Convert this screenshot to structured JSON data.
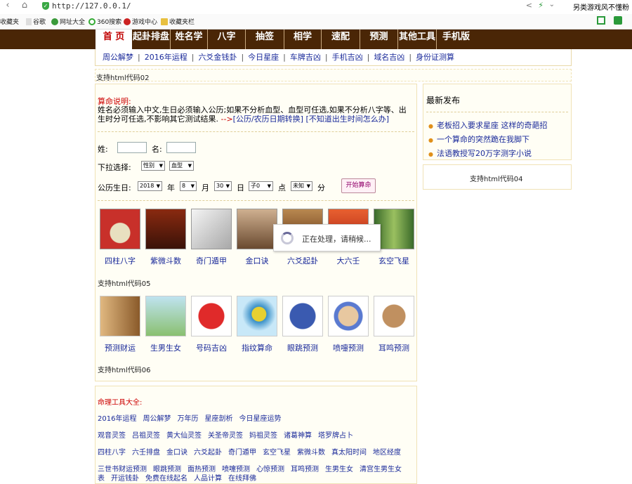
{
  "browser": {
    "url": "http://127.0.0.1/",
    "right_text": "另类游戏风不懂粉",
    "bookmarks": [
      {
        "label": "收藏夹",
        "color": "#f0b030"
      },
      {
        "label": "谷歌",
        "color": "#bbbbbb"
      },
      {
        "label": "网址大全",
        "color": "#3a9a3a"
      },
      {
        "label": "360搜索",
        "color": "#33aa33"
      },
      {
        "label": "游戏中心",
        "color": "#cc2222"
      },
      {
        "label": "收藏夹栏",
        "color": "#e8c040"
      }
    ]
  },
  "main_nav": [
    "首 页",
    "起卦排盘",
    "姓名学",
    "八字",
    "抽签",
    "相学",
    "速配",
    "预测",
    "其他工具",
    "手机版"
  ],
  "sub_nav": [
    "周公解梦",
    "2016年运程",
    "六爻金钱卦",
    "今日星座",
    "车牌吉凶",
    "手机吉凶",
    "域名吉凶",
    "身份证测算"
  ],
  "code_labels": {
    "c02": "支持html代码02",
    "c04": "支持html代码04",
    "c05": "支持html代码05",
    "c06": "支持html代码06"
  },
  "note": {
    "title": "算命说明:",
    "line1": "姓名必须输入中文,生日必须输入公历;如果不分析血型、血型可任选,如果不分析八字等、出生时分可任选,不影响其它测试结果.",
    "arrow": "-->",
    "link1": "[公历/农历日期转换]",
    "link2": "[不知道出生时间怎么办]"
  },
  "form": {
    "surname_label": "姓:",
    "name_label": "名:",
    "dropdown_label": "下拉选择:",
    "gender": "性别",
    "blood": "血型",
    "birth_label": "公历生日:",
    "year": "2018",
    "year_unit": "年",
    "month": "8",
    "month_unit": "月",
    "day": "30",
    "day_unit": "日",
    "hour": "子0",
    "hour_unit": "点",
    "minute": "未知",
    "minute_unit": "分",
    "submit": "开始算命"
  },
  "tiles_row1": [
    {
      "label": "四柱八字",
      "color": "#c8302a"
    },
    {
      "label": "紫微斗数",
      "color": "#8a2a10"
    },
    {
      "label": "奇门遁甲",
      "color": "#c8c8c8"
    },
    {
      "label": "金口诀",
      "color": "#a88060"
    },
    {
      "label": "六爻起卦",
      "color": "#a06a30"
    },
    {
      "label": "大六壬",
      "color": "#d84020"
    },
    {
      "label": "玄空飞星",
      "color": "#5a8a3a"
    }
  ],
  "tiles_row2": [
    {
      "label": "预测财运",
      "color": "#c89a5a"
    },
    {
      "label": "生男生女",
      "color": "#aac890"
    },
    {
      "label": "号码吉凶",
      "color": "#e83a3a"
    },
    {
      "label": "指纹算命",
      "color": "#4aa0d0"
    },
    {
      "label": "眼跳预测",
      "color": "#3a6ab0"
    },
    {
      "label": "喷嚏预测",
      "color": "#6a8ad0"
    },
    {
      "label": "耳鸣预测",
      "color": "#a0703a"
    }
  ],
  "loading_text": "正在处理，请稍候...",
  "sidebar": {
    "title": "最新发布",
    "items": [
      "老板招入要求星座 这样的奇葩招",
      "一个算命的突然跪在我脚下",
      "法语教授写20万字测字小说"
    ]
  },
  "tools": {
    "title": "命理工具大全:",
    "rows": [
      [
        "2016年运程",
        "周公解梦",
        "万年历",
        "星座剖析",
        "今日星座运势"
      ],
      [
        "观音灵签",
        "吕祖灵签",
        "黄大仙灵签",
        "关圣帝灵签",
        "妈祖灵签",
        "诸葛神算",
        "塔罗牌占卜"
      ],
      [
        "四柱八字",
        "六壬排盘",
        "金口诀",
        "六爻起卦",
        "奇门遁甲",
        "玄空飞星",
        "紫微斗数",
        "真太阳时间",
        "地区经度"
      ],
      [
        "三世书财运预测",
        "眼跳预测",
        "面热预测",
        "喷嚏预测",
        "心惊预测",
        "耳鸣预测",
        "生男生女",
        "清宫生男生女"
      ],
      [
        "表",
        "开运钱卦",
        "免费在线起名",
        "人品计算",
        "在线拜佛"
      ]
    ]
  }
}
